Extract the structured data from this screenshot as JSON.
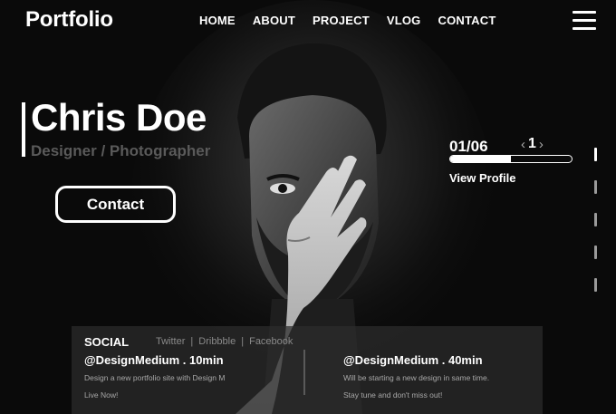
{
  "brand": {
    "logo": "Portfolio"
  },
  "nav": {
    "items": [
      "HOME",
      "ABOUT",
      "PROJECT",
      "VLOG",
      "CONTACT"
    ]
  },
  "hero": {
    "name": "Chris Doe",
    "role": "Designer / Photographer",
    "contact_label": "Contact"
  },
  "slider": {
    "counter": "01/06",
    "prev_icon": "chevron-left",
    "current": "1",
    "next_icon": "chevron-right",
    "progress": 0.5,
    "view_profile": "View Profile"
  },
  "side_dots": {
    "count": 5,
    "active": 0
  },
  "social": {
    "title": "SOCIAL",
    "links": [
      "Twitter",
      "Dribbble",
      "Facebook"
    ],
    "posts": [
      {
        "handle": "@DesignMedium . 10min",
        "line1": "Design a new portfolio site with Design M",
        "line2": "Live Now!"
      },
      {
        "handle": "@DesignMedium . 40min",
        "line1": "Will be starting a new design in same time.",
        "line2": "Stay tune and don't miss out!"
      }
    ]
  },
  "colors": {
    "background": "#0a0a0a",
    "accent": "#ffffff",
    "muted": "#5a5a5a"
  }
}
